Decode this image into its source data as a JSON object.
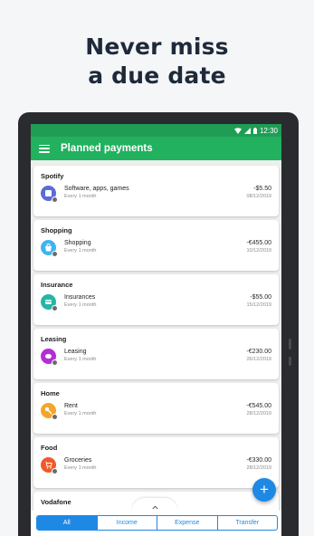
{
  "headline": {
    "line1": "Never miss",
    "line2": "a due date"
  },
  "status_bar": {
    "time": "12:30"
  },
  "app_bar": {
    "title": "Planned payments"
  },
  "payments": [
    {
      "title": "Spotify",
      "name": "Software, apps, games",
      "frequency": "Every 1 month",
      "amount": "-$5.50",
      "date": "08/12/2019",
      "color": "#5c6bd8",
      "icon": "software-icon"
    },
    {
      "title": "Shopping",
      "name": "Shopping",
      "frequency": "Every 1 month",
      "amount": "-€455.00",
      "date": "10/12/2019",
      "color": "#3fb4ee",
      "icon": "shopping-bag-icon"
    },
    {
      "title": "Insurance",
      "name": "Insurances",
      "frequency": "Every 1 month",
      "amount": "-$55.00",
      "date": "15/12/2019",
      "color": "#26b5a6",
      "icon": "insurance-icon"
    },
    {
      "title": "Leasing",
      "name": "Leasing",
      "frequency": "Every 1 month",
      "amount": "-€230.00",
      "date": "26/12/2019",
      "color": "#b22fd6",
      "icon": "leasing-icon"
    },
    {
      "title": "Home",
      "name": "Rent",
      "frequency": "Every 1 month",
      "amount": "-€545.00",
      "date": "28/12/2019",
      "color": "#f2a62a",
      "icon": "key-icon"
    },
    {
      "title": "Food",
      "name": "Groceries",
      "frequency": "Every 1 month",
      "amount": "-€330.00",
      "date": "28/12/2019",
      "color": "#ef5a2a",
      "icon": "groceries-icon"
    },
    {
      "title": "Vodafone",
      "name": "",
      "frequency": "",
      "amount": "",
      "date": "",
      "color": "#9e9e9e",
      "icon": ""
    }
  ],
  "fab": {
    "label": "+"
  },
  "tabs": [
    {
      "label": "All",
      "active": true
    },
    {
      "label": "Income",
      "active": false
    },
    {
      "label": "Expense",
      "active": false
    },
    {
      "label": "Transfer",
      "active": false
    }
  ],
  "colors": {
    "appbar": "#22b15f",
    "statusbar": "#1f9d55",
    "accent": "#1e88e5"
  }
}
